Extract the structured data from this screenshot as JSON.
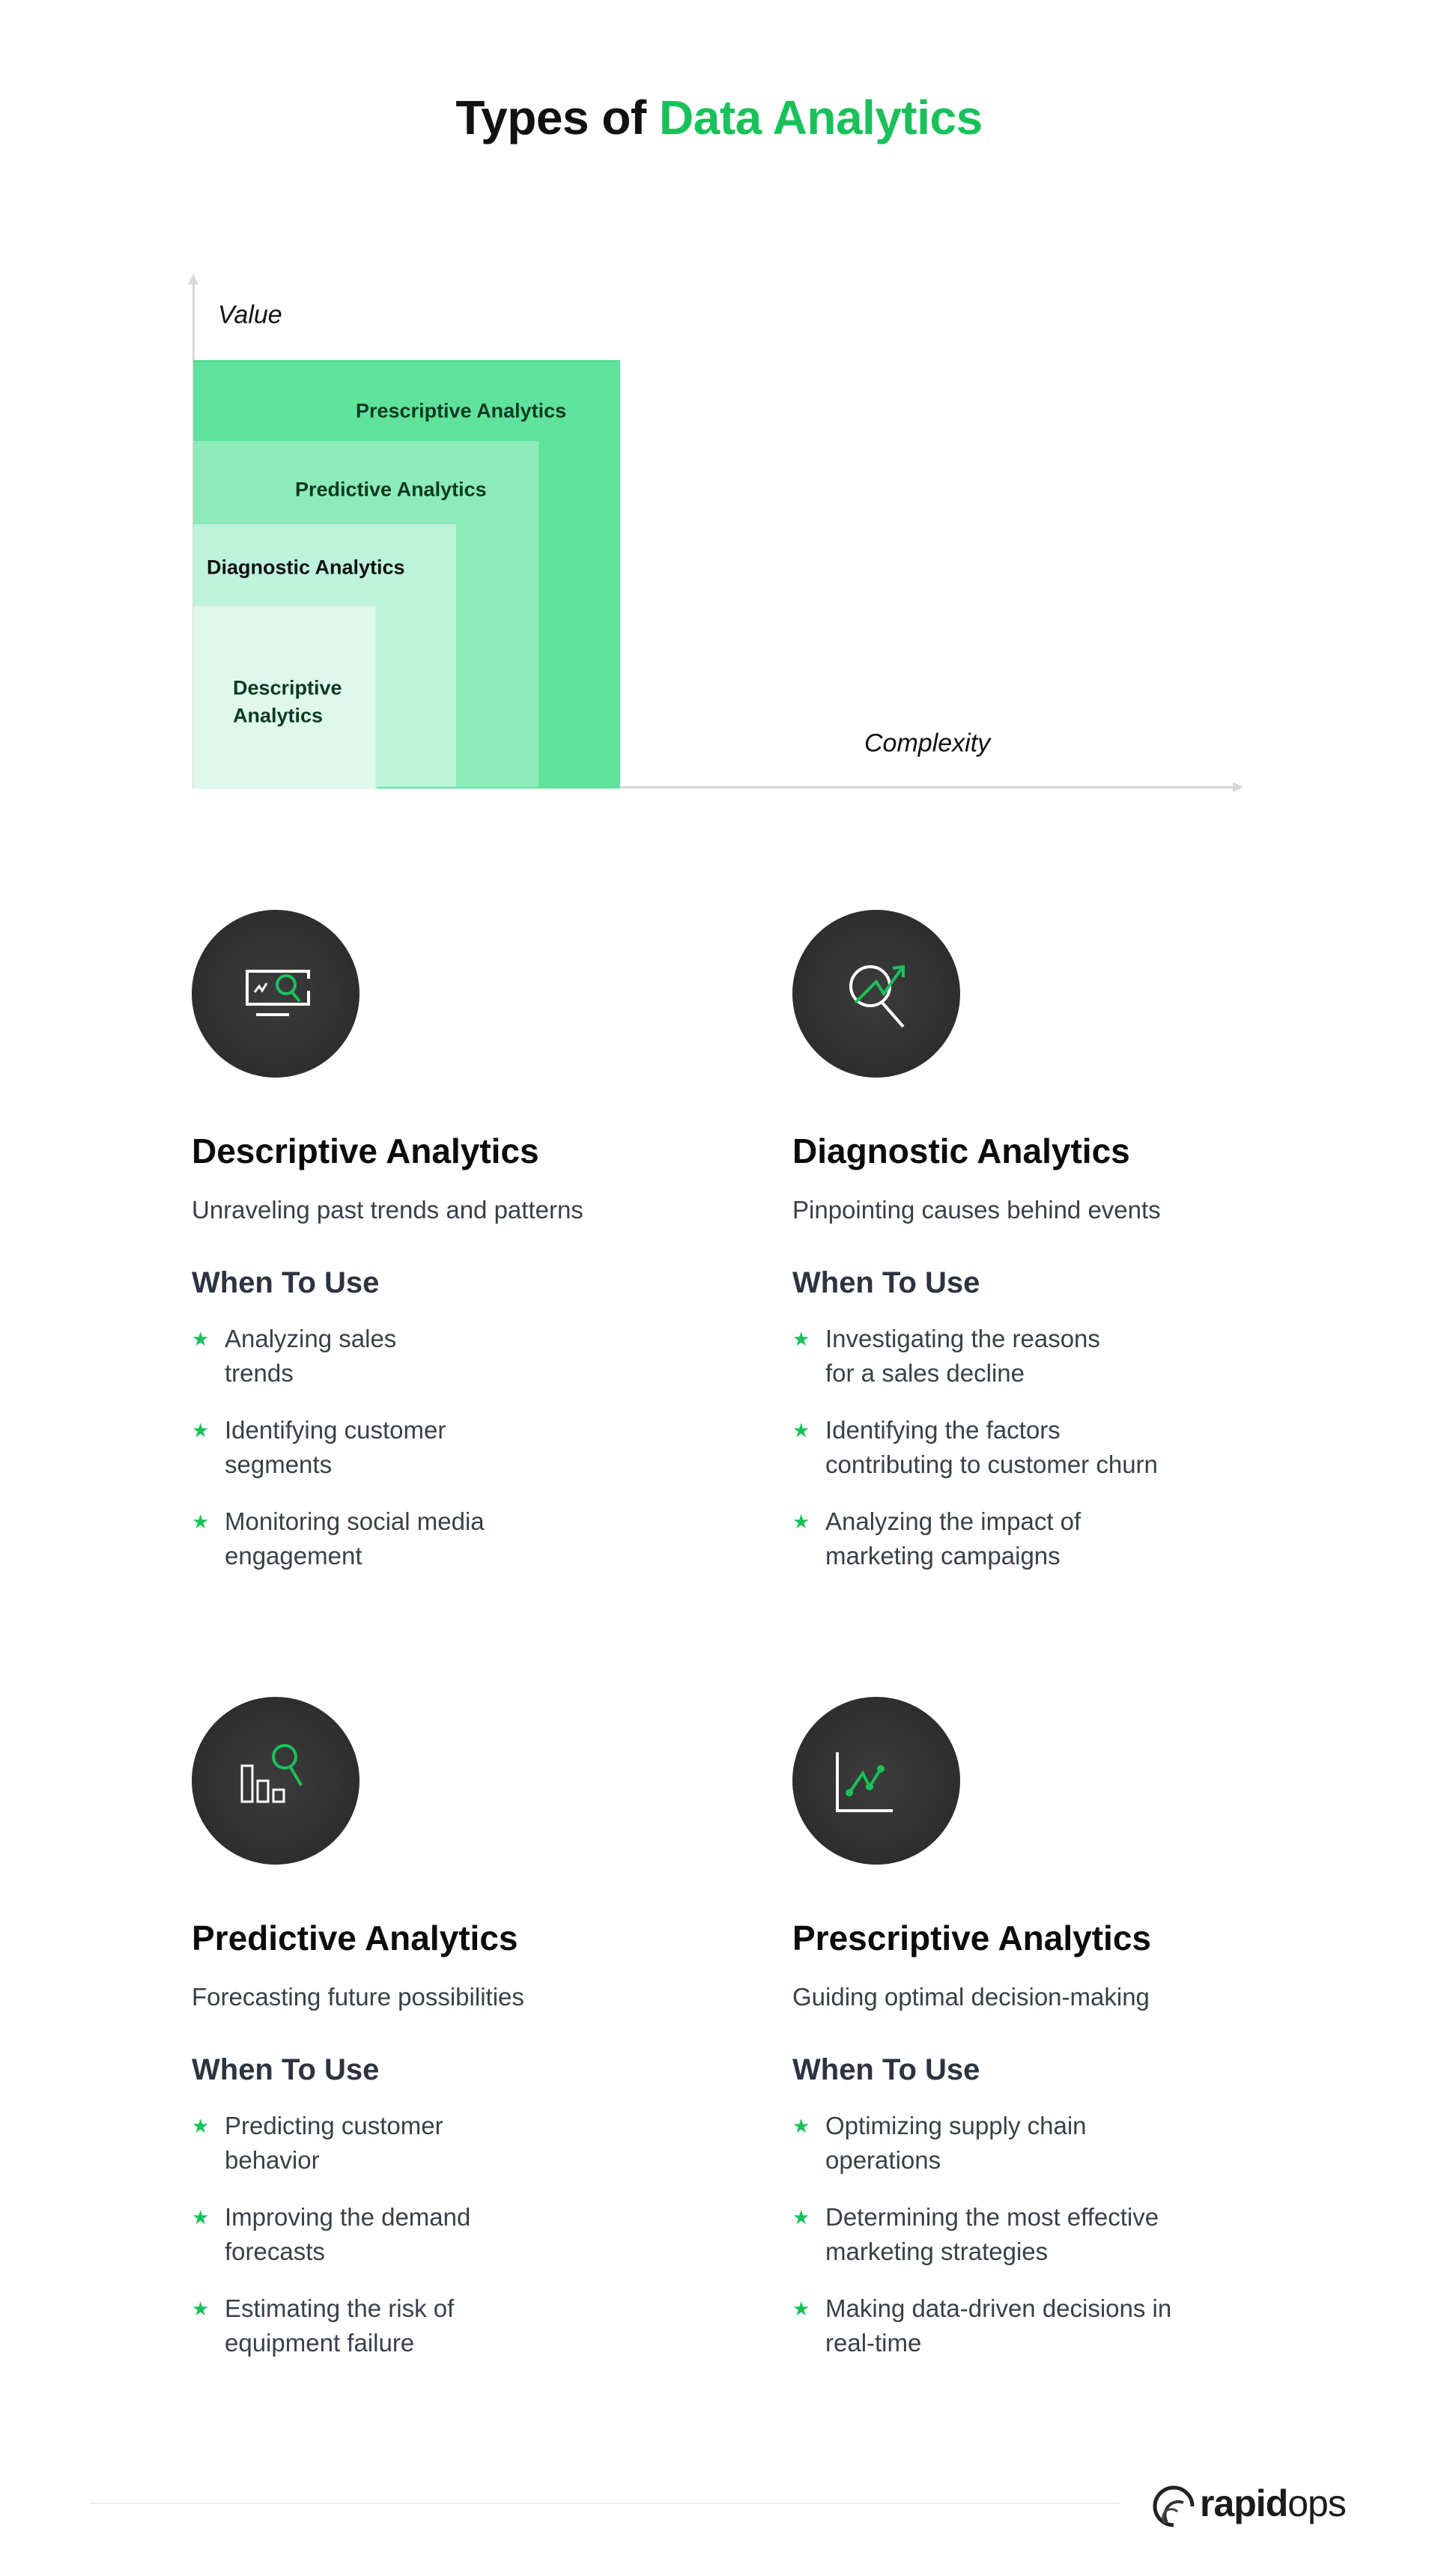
{
  "title": {
    "prefix": "Types of ",
    "highlight": "Data Analytics"
  },
  "diagram": {
    "y_axis_label": "Value",
    "x_axis_label": "Complexity",
    "layers": [
      {
        "label": "Prescriptive Analytics",
        "color": "#5fe39c"
      },
      {
        "label": "Predictive Analytics",
        "color": "#8deab9"
      },
      {
        "label": "Diagnostic Analytics",
        "color": "#bdf3da"
      },
      {
        "label_line1": "Descriptive",
        "label_line2": "Analytics",
        "color": "#dff8ec"
      }
    ]
  },
  "cards": [
    {
      "title": "Descriptive Analytics",
      "subtitle": "Unraveling past trends and patterns",
      "icon": "monitor-magnifier-icon",
      "when_label": "When To Use",
      "items": [
        [
          "Analyzing sales",
          "trends"
        ],
        [
          "Identifying customer",
          "segments"
        ],
        [
          "Monitoring social media",
          "engagement"
        ]
      ]
    },
    {
      "title": "Diagnostic Analytics",
      "subtitle": "Pinpointing causes behind events",
      "icon": "magnifier-trend-icon",
      "when_label": "When To Use",
      "items": [
        [
          "Investigating the reasons",
          "for a sales decline"
        ],
        [
          "Identifying the factors",
          "contributing to customer churn"
        ],
        [
          "Analyzing the impact of",
          "marketing campaigns"
        ]
      ]
    },
    {
      "title": "Predictive Analytics",
      "subtitle": "Forecasting future possibilities",
      "icon": "bar-chart-magnifier-icon",
      "when_label": "When To Use",
      "items": [
        [
          "Predicting customer",
          "behavior"
        ],
        [
          "Improving the demand",
          "forecasts"
        ],
        [
          "Estimating the risk of",
          "equipment failure"
        ]
      ]
    },
    {
      "title": "Prescriptive Analytics",
      "subtitle": "Guiding optimal decision-making",
      "icon": "line-chart-icon",
      "when_label": "When To Use",
      "items": [
        [
          "Optimizing supply chain",
          "operations"
        ],
        [
          "Determining the most effective",
          "marketing strategies"
        ],
        [
          "Making data-driven decisions in",
          "real-time"
        ]
      ]
    }
  ],
  "footer": {
    "logo_bold": "rapid",
    "logo_light": "ops"
  },
  "colors": {
    "accent": "#19c15a",
    "icon_bg": "#2e2e2e",
    "heading": "#0b0b0b",
    "subheading": "#2d3340"
  }
}
